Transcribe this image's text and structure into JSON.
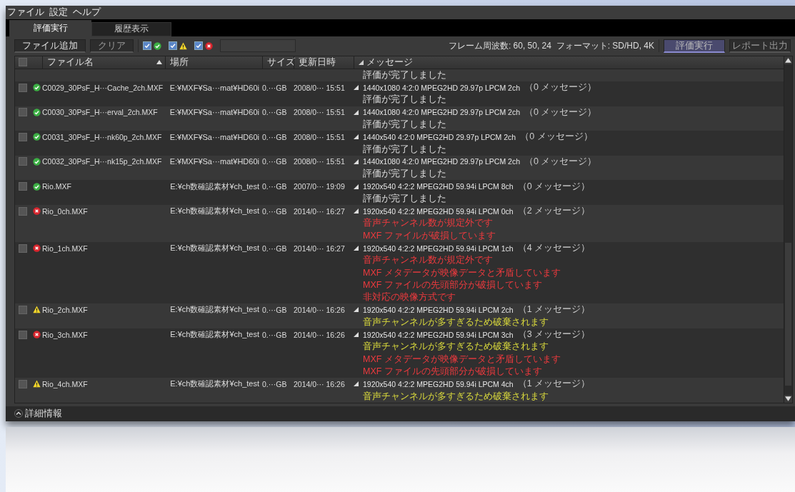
{
  "menu": [
    "ファイル",
    "設定",
    "ヘルプ"
  ],
  "tabs": [
    {
      "label": "評価実行",
      "selected": true
    },
    {
      "label": "履歴表示",
      "selected": false
    }
  ],
  "toolbar": {
    "add_button": {
      "label": "ファイル追加",
      "disabled": false
    },
    "clear_button": {
      "label": "クリア",
      "disabled": true
    },
    "filters": [
      {
        "kind": "ok",
        "checked": true
      },
      {
        "kind": "warning",
        "checked": true
      },
      {
        "kind": "error",
        "checked": true
      }
    ],
    "info": "フレーム周波数: 60, 50, 24  フォーマット: SD/HD, 4K",
    "run_button": {
      "label": "評価実行",
      "disabled": false
    },
    "report_button": {
      "label": "レポート出力",
      "disabled": true
    }
  },
  "columns": {
    "filename": "ファイル名",
    "location": "場所",
    "size": "サイズ",
    "date": "更新日時",
    "message": "メッセージ"
  },
  "select_all_checked": false,
  "top_partial_message": {
    "text": "評価が完了しました",
    "kind": "ok"
  },
  "rows": [
    {
      "checked": false,
      "kind": "ok",
      "filename": "C0029_30PsF_H···Cache_2ch.MXF",
      "location": "E:¥MXF¥Sa···mat¥HD60i",
      "size": "0.···GB",
      "date": "2008/0··· 15:51",
      "format": "1440x1080 4:2:0 MPEG2HD 29.97p LPCM 2ch",
      "count": "（0 メッセージ）",
      "messages": [
        {
          "text": "評価が完了しました",
          "kind": "ok"
        }
      ]
    },
    {
      "checked": false,
      "kind": "ok",
      "filename": "C0030_30PsF_H···erval_2ch.MXF",
      "location": "E:¥MXF¥Sa···mat¥HD60i",
      "size": "0.···GB",
      "date": "2008/0··· 15:51",
      "format": "1440x1080 4:2:0 MPEG2HD 29.97p LPCM 2ch",
      "count": "（0 メッセージ）",
      "messages": [
        {
          "text": "評価が完了しました",
          "kind": "ok"
        }
      ]
    },
    {
      "checked": false,
      "kind": "ok",
      "filename": "C0031_30PsF_H···nk60p_2ch.MXF",
      "location": "E:¥MXF¥Sa···mat¥HD60i",
      "size": "0.···GB",
      "date": "2008/0··· 15:51",
      "format": "1440x540 4:2:0 MPEG2HD 29.97p LPCM 2ch",
      "count": "（0 メッセージ）",
      "messages": [
        {
          "text": "評価が完了しました",
          "kind": "ok"
        }
      ]
    },
    {
      "checked": false,
      "kind": "ok",
      "filename": "C0032_30PsF_H···nk15p_2ch.MXF",
      "location": "E:¥MXF¥Sa···mat¥HD60i",
      "size": "0.···GB",
      "date": "2008/0··· 15:51",
      "format": "1440x1080 4:2:0 MPEG2HD 29.97p LPCM 2ch",
      "count": "（0 メッセージ）",
      "messages": [
        {
          "text": "評価が完了しました",
          "kind": "ok"
        }
      ]
    },
    {
      "checked": false,
      "kind": "ok",
      "filename": "Rio.MXF",
      "location": "E:¥ch数確認素材¥ch_test",
      "size": "0.···GB",
      "date": "2007/0··· 19:09",
      "format": "1920x540 4:2:2 MPEG2HD 59.94i LPCM 8ch",
      "count": "（0 メッセージ）",
      "messages": [
        {
          "text": "評価が完了しました",
          "kind": "ok"
        }
      ]
    },
    {
      "checked": false,
      "kind": "error",
      "filename": "Rio_0ch.MXF",
      "location": "E:¥ch数確認素材¥ch_test",
      "size": "0.···GB",
      "date": "2014/0··· 16:27",
      "format": "1920x540 4:2:2 MPEG2HD 59.94i LPCM 0ch",
      "count": "（2 メッセージ）",
      "messages": [
        {
          "text": "音声チャンネル数が規定外です",
          "kind": "error"
        },
        {
          "text": "MXF ファイルが破損しています",
          "kind": "error"
        }
      ]
    },
    {
      "checked": false,
      "kind": "error",
      "filename": "Rio_1ch.MXF",
      "location": "E:¥ch数確認素材¥ch_test",
      "size": "0.···GB",
      "date": "2014/0··· 16:27",
      "format": "1920x540 4:2:2 MPEG2HD 59.94i LPCM 1ch",
      "count": "（4 メッセージ）",
      "messages": [
        {
          "text": "音声チャンネル数が規定外です",
          "kind": "error"
        },
        {
          "text": "MXF メタデータが映像データと矛盾しています",
          "kind": "error"
        },
        {
          "text": "MXF ファイルの先頭部分が破損しています",
          "kind": "error"
        },
        {
          "text": "非対応の映像方式です",
          "kind": "error"
        }
      ]
    },
    {
      "checked": false,
      "kind": "warning",
      "filename": "Rio_2ch.MXF",
      "location": "E:¥ch数確認素材¥ch_test",
      "size": "0.···GB",
      "date": "2014/0··· 16:26",
      "format": "1920x540 4:2:2 MPEG2HD 59.94i LPCM 2ch",
      "count": "（1 メッセージ）",
      "messages": [
        {
          "text": "音声チャンネルが多すぎるため破棄されます",
          "kind": "warning"
        }
      ]
    },
    {
      "checked": false,
      "kind": "error",
      "filename": "Rio_3ch.MXF",
      "location": "E:¥ch数確認素材¥ch_test",
      "size": "0.···GB",
      "date": "2014/0··· 16:26",
      "format": "1920x540 4:2:2 MPEG2HD 59.94i LPCM 3ch",
      "count": "（3 メッセージ）",
      "messages": [
        {
          "text": "音声チャンネルが多すぎるため破棄されます",
          "kind": "warning"
        },
        {
          "text": "MXF メタデータが映像データと矛盾しています",
          "kind": "error"
        },
        {
          "text": "MXF ファイルの先頭部分が破損しています",
          "kind": "error"
        }
      ]
    },
    {
      "checked": false,
      "kind": "warning",
      "filename": "Rio_4ch.MXF",
      "location": "E:¥ch数確認素材¥ch_test",
      "size": "0.···GB",
      "date": "2014/0··· 16:26",
      "format": "1920x540 4:2:2 MPEG2HD 59.94i LPCM 4ch",
      "count": "（1 メッセージ）",
      "messages": [
        {
          "text": "音声チャンネルが多すぎるため破棄されます",
          "kind": "warning"
        }
      ]
    }
  ],
  "details_panel": {
    "label": "詳細情報",
    "expanded": false
  }
}
